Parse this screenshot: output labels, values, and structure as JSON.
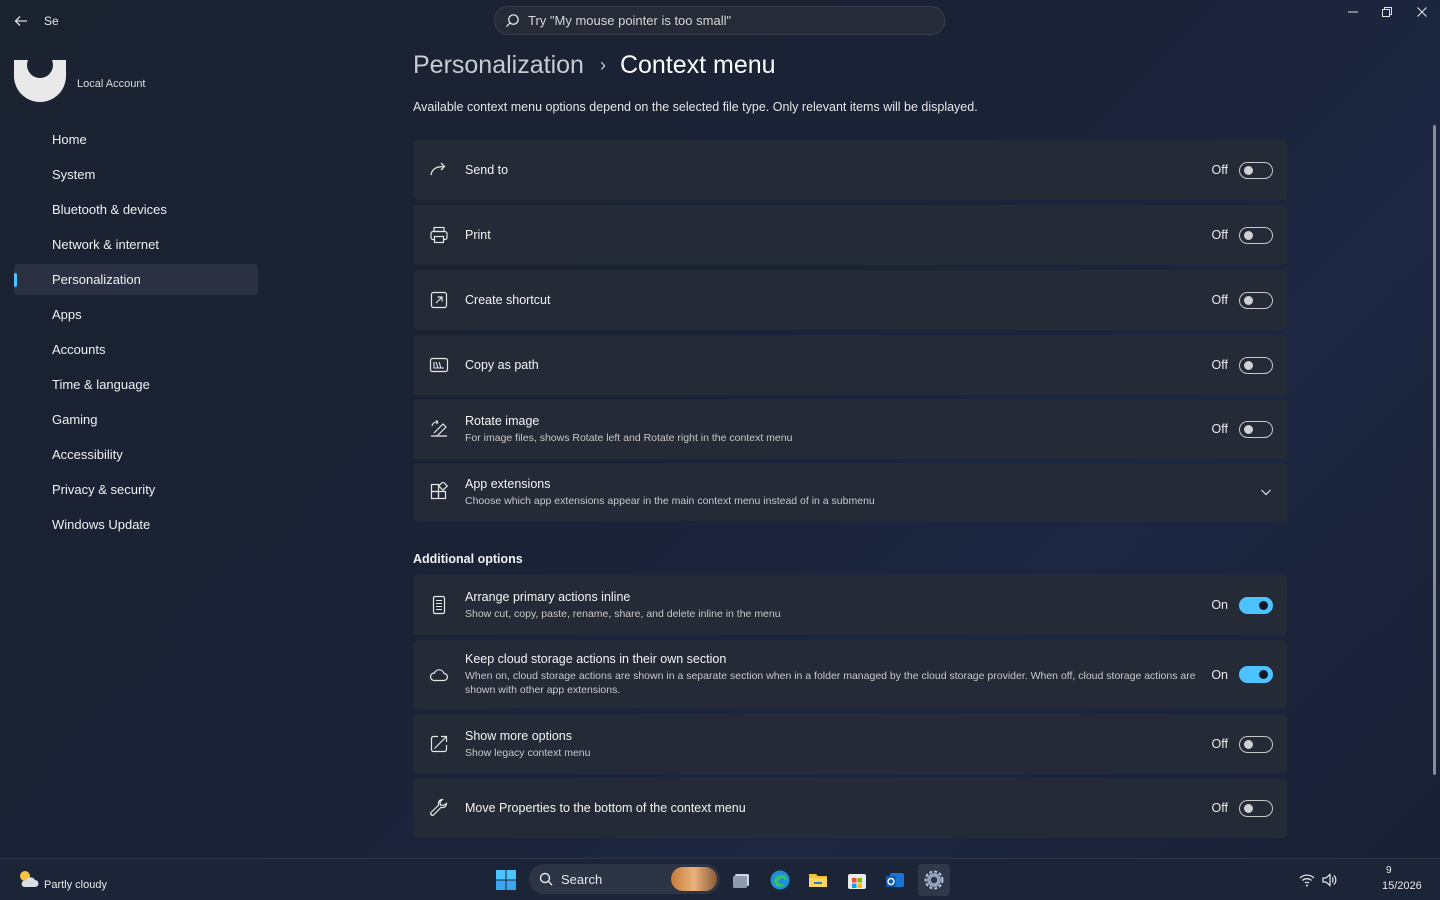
{
  "window": {
    "app_title": "Se",
    "search_placeholder": "Try \"My mouse pointer is too small\""
  },
  "account": {
    "label": "Local Account"
  },
  "sidebar": {
    "items": [
      {
        "label": "Home"
      },
      {
        "label": "System"
      },
      {
        "label": "Bluetooth & devices"
      },
      {
        "label": "Network & internet"
      },
      {
        "label": "Personalization",
        "active": true
      },
      {
        "label": "Apps"
      },
      {
        "label": "Accounts"
      },
      {
        "label": "Time & language"
      },
      {
        "label": "Gaming"
      },
      {
        "label": "Accessibility"
      },
      {
        "label": "Privacy & security"
      },
      {
        "label": "Windows Update"
      }
    ]
  },
  "breadcrumb": {
    "parent": "Personalization",
    "separator": "›",
    "current": "Context menu"
  },
  "description": "Available context menu options depend on the selected file type. Only relevant items will be displayed.",
  "settings": [
    {
      "title": "Send to",
      "state": "Off",
      "on": false,
      "icon": "share-arrow-icon"
    },
    {
      "title": "Print",
      "state": "Off",
      "on": false,
      "icon": "printer-icon"
    },
    {
      "title": "Create shortcut",
      "state": "Off",
      "on": false,
      "icon": "shortcut-icon"
    },
    {
      "title": "Copy as path",
      "state": "Off",
      "on": false,
      "icon": "path-icon"
    },
    {
      "title": "Rotate image",
      "subtitle": "For image files, shows Rotate left and Rotate right in the context menu",
      "state": "Off",
      "on": false,
      "icon": "rotate-icon"
    },
    {
      "title": "App extensions",
      "subtitle": "Choose which app extensions appear in the main context menu instead of in a submenu",
      "icon": "apps-grid-icon",
      "expandable": true
    }
  ],
  "additional": {
    "header": "Additional options",
    "items": [
      {
        "title": "Arrange primary actions inline",
        "subtitle": "Show cut, copy, paste, rename, share, and delete inline in the menu",
        "state": "On",
        "on": true,
        "icon": "list-icon"
      },
      {
        "title": "Keep cloud storage actions in their own section",
        "subtitle": "When on, cloud storage actions are shown in a separate section when in a folder managed by the cloud storage provider. When off, cloud storage actions are shown with other app extensions.",
        "state": "On",
        "on": true,
        "icon": "cloud-icon"
      },
      {
        "title": "Show more options",
        "subtitle": "Show legacy context menu",
        "state": "Off",
        "on": false,
        "icon": "expand-icon"
      },
      {
        "title": "Move Properties to the bottom of the context menu",
        "state": "Off",
        "on": false,
        "icon": "wrench-icon"
      }
    ]
  },
  "taskbar": {
    "weather_condition": "Partly cloudy",
    "weather_temp": "",
    "search_label": "Search",
    "clock_time": "9",
    "clock_date": "15/2026"
  },
  "colors": {
    "accent": "#4cc2ff",
    "card": "#252a37"
  }
}
